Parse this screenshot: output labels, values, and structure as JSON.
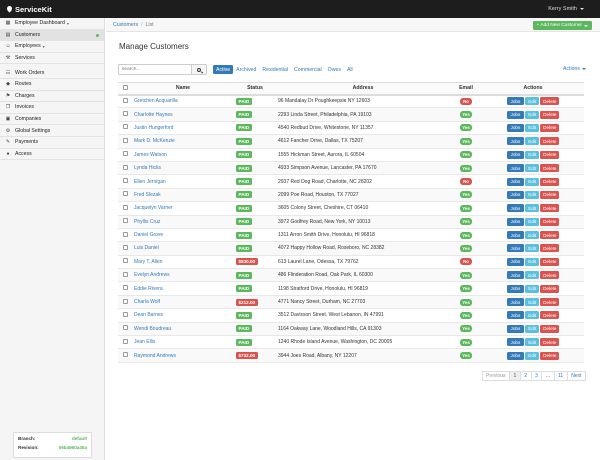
{
  "app": {
    "name": "ServiceKit",
    "user": "Kerry Smith"
  },
  "sidebar": {
    "items": [
      {
        "label": "Employee Dashboard",
        "icon": "dashboard-icon",
        "caret": true,
        "active": false
      },
      {
        "label": "Customers",
        "icon": "customers-icon",
        "caret": false,
        "active": true,
        "dot": true
      },
      {
        "label": "Employees",
        "icon": "employees-icon",
        "caret": true,
        "active": false
      },
      {
        "label": "Services",
        "icon": "wrench-icon",
        "caret": false,
        "active": false
      },
      {
        "label": "Work Orders",
        "icon": "work-orders-icon",
        "caret": false,
        "active": false
      },
      {
        "label": "Routes",
        "icon": "route-pin-icon",
        "caret": false,
        "active": false
      },
      {
        "label": "Charges",
        "icon": "charges-icon",
        "caret": false,
        "active": false
      },
      {
        "label": "Invoices",
        "icon": "invoices-icon",
        "caret": false,
        "active": false
      },
      {
        "label": "Companies",
        "icon": "companies-icon",
        "caret": false,
        "active": false
      },
      {
        "label": "Global Settings",
        "icon": "settings-icon",
        "caret": false,
        "active": false
      },
      {
        "label": "Payments",
        "icon": "payments-icon",
        "caret": false,
        "active": false
      },
      {
        "label": "Access",
        "icon": "access-icon",
        "caret": false,
        "active": false
      }
    ],
    "branch": {
      "branch_label": "Branch:",
      "branch_value": "default",
      "revision_label": "Revision:",
      "revision_value": "06b4960a45a"
    }
  },
  "breadcrumb": {
    "link": "Customers",
    "current": "List"
  },
  "add_button": "+ Add New Customer",
  "page_title": "Manage Customers",
  "search": {
    "placeholder": "search..."
  },
  "filters": [
    {
      "label": "Active",
      "active": true
    },
    {
      "label": "Archived",
      "active": false
    },
    {
      "label": "Residential",
      "active": false
    },
    {
      "label": "Commercial",
      "active": false
    },
    {
      "label": "Owes",
      "active": false
    },
    {
      "label": "All",
      "active": false
    }
  ],
  "actions_dropdown": "Actions",
  "table": {
    "headers": {
      "name": "Name",
      "status": "Status",
      "address": "Address",
      "email": "Email",
      "actions": "Actions"
    },
    "button_labels": {
      "jobs": "Jobs",
      "edit": "Edit",
      "delete": "Delete"
    },
    "rows": [
      {
        "name": "Gretchen Acquarilla",
        "status": "PAID",
        "address": "96 Mandalay Dr Poughkeepsie NY 12603",
        "email": "No"
      },
      {
        "name": "Charlotte Haynes",
        "status": "PAID",
        "address": "2293 Linda Street, Philadelphia, PA 19103",
        "email": "Yes"
      },
      {
        "name": "Justin Hungerford",
        "status": "PAID",
        "address": "4540 Redbud Drive, Whitestone, NY 11357",
        "email": "Yes"
      },
      {
        "name": "Mark D. McKenzie",
        "status": "PAID",
        "address": "4612 Fancher Drive, Dallas, TX 75207",
        "email": "Yes"
      },
      {
        "name": "James Watson",
        "status": "PAID",
        "address": "1555 Hickman Street, Aurora, IL 60504",
        "email": "Yes"
      },
      {
        "name": "Lynda Hicks",
        "status": "PAID",
        "address": "4933 Simpson Avenue, Lancaster, PA 17670",
        "email": "Yes"
      },
      {
        "name": "Ellen Jernigan",
        "status": "PAID",
        "address": "2937 Red Dog Road, Charlotte, NC 28202",
        "email": "No"
      },
      {
        "name": "Fred Slezak",
        "status": "PAID",
        "address": "2099 Poe Road, Houston, TX 77027",
        "email": "Yes"
      },
      {
        "name": "Jacquelyn Varner",
        "status": "PAID",
        "address": "3605 Colony Street, Cheshire, CT 06410",
        "email": "Yes"
      },
      {
        "name": "Phyllis Cruz",
        "status": "PAID",
        "address": "3972 Godfrey Road, New York, NY 10013",
        "email": "Yes"
      },
      {
        "name": "Daniel Grove",
        "status": "PAID",
        "address": "1311 Arron Smith Drive, Honolulu, HI 96818",
        "email": "Yes"
      },
      {
        "name": "Luis Daniel",
        "status": "PAID",
        "address": "4072 Happy Hollow Road, Roseboro, NC 28382",
        "email": "Yes"
      },
      {
        "name": "Mary T. Allen",
        "status": "$830.00",
        "address": "613 Laurel Lane, Odessa, TX 79762",
        "email": "No"
      },
      {
        "name": "Evelyn Andrews",
        "status": "PAID",
        "address": "486 Flinderation Road, Oak Park, IL 60300",
        "email": "Yes"
      },
      {
        "name": "Eddie Rivera",
        "status": "PAID",
        "address": "1198 Stratford Drive, Honolulu, HI 96819",
        "email": "Yes"
      },
      {
        "name": "Charla Wolf",
        "status": "$212.00",
        "address": "4771 Nancy Street, Durham, NC 27703",
        "email": "Yes"
      },
      {
        "name": "Dean Barnes",
        "status": "PAID",
        "address": "3512 Davisson Street, West Lebanon, IN 47991",
        "email": "Yes"
      },
      {
        "name": "Wendi Boudreau",
        "status": "PAID",
        "address": "1164 Oakway Lane, Woodland Hills, CA 91303",
        "email": "Yes"
      },
      {
        "name": "Jean Ellis",
        "status": "PAID",
        "address": "1240 Rhode Island Avenue, Washington, DC 20005",
        "email": "Yes"
      },
      {
        "name": "Raymond Andrews",
        "status": "$732.00",
        "address": "3944 Joes Road, Albany, NY 12207",
        "email": "Yes"
      }
    ]
  },
  "pagination": [
    "Previous",
    "1",
    "2",
    "3",
    "...",
    "11",
    "Next"
  ],
  "colors": {
    "primary": "#337ab7",
    "success": "#5cb85c",
    "danger": "#d9534f",
    "info": "#5bc0de",
    "topbar": "#1d1d1d"
  }
}
